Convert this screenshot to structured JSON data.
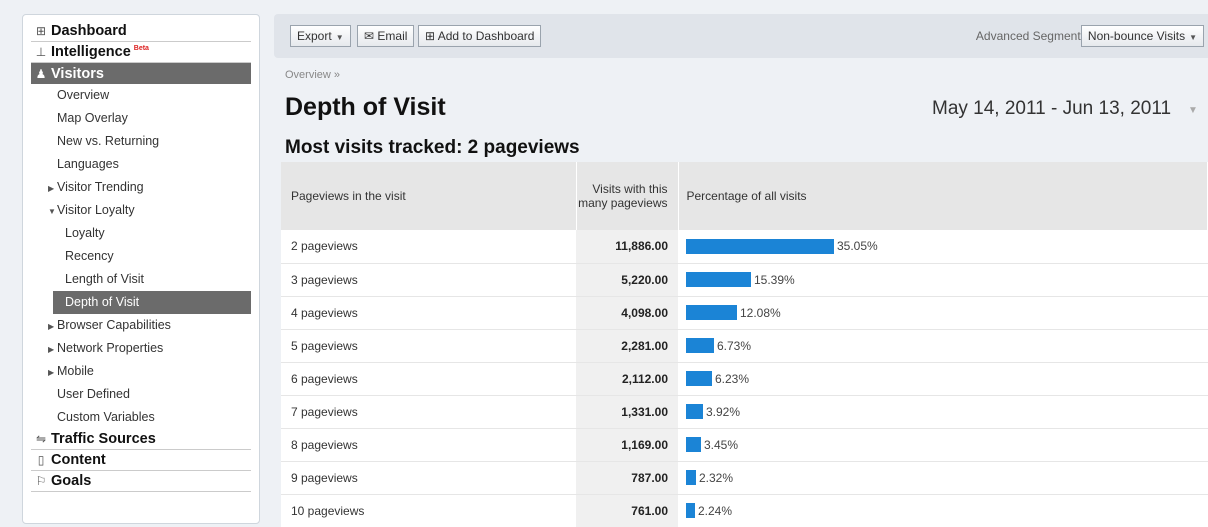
{
  "sidebar": {
    "dashboard": "Dashboard",
    "intelligence": "Intelligence",
    "beta": "Beta",
    "visitors": "Visitors",
    "items": [
      {
        "label": "Overview"
      },
      {
        "label": "Map Overlay"
      },
      {
        "label": "New vs. Returning"
      },
      {
        "label": "Languages"
      },
      {
        "label": "Visitor Trending"
      },
      {
        "label": "Visitor Loyalty"
      },
      {
        "label": "Loyalty"
      },
      {
        "label": "Recency"
      },
      {
        "label": "Length of Visit"
      },
      {
        "label": "Depth of Visit"
      },
      {
        "label": "Browser Capabilities"
      },
      {
        "label": "Network Properties"
      },
      {
        "label": "Mobile"
      },
      {
        "label": "User Defined"
      },
      {
        "label": "Custom Variables"
      }
    ],
    "traffic_sources": "Traffic Sources",
    "content": "Content",
    "goals": "Goals"
  },
  "toolbar": {
    "export_label": "Export",
    "email_label": "Email",
    "add_dashboard_label": "Add to Dashboard",
    "advanced_segments_label": "Advanced Segments:",
    "segment_value": "Non-bounce Visits"
  },
  "breadcrumb": "Overview »",
  "page_title": "Depth of Visit",
  "date_range": "May 14, 2011 - Jun 13, 2011",
  "subtitle": "Most visits tracked: 2 pageviews",
  "table": {
    "headers": [
      "Pageviews in the visit",
      "Visits with this many pageviews",
      "Percentage of all visits"
    ],
    "rows": [
      {
        "label": "2 pageviews",
        "visits": "11,886.00",
        "pct": "35.05%",
        "pct_value": 35.05
      },
      {
        "label": "3 pageviews",
        "visits": "5,220.00",
        "pct": "15.39%",
        "pct_value": 15.39
      },
      {
        "label": "4 pageviews",
        "visits": "4,098.00",
        "pct": "12.08%",
        "pct_value": 12.08
      },
      {
        "label": "5 pageviews",
        "visits": "2,281.00",
        "pct": "6.73%",
        "pct_value": 6.73
      },
      {
        "label": "6 pageviews",
        "visits": "2,112.00",
        "pct": "6.23%",
        "pct_value": 6.23
      },
      {
        "label": "7 pageviews",
        "visits": "1,331.00",
        "pct": "3.92%",
        "pct_value": 3.92
      },
      {
        "label": "8 pageviews",
        "visits": "1,169.00",
        "pct": "3.45%",
        "pct_value": 3.45
      },
      {
        "label": "9 pageviews",
        "visits": "787.00",
        "pct": "2.32%",
        "pct_value": 2.32
      },
      {
        "label": "10 pageviews",
        "visits": "761.00",
        "pct": "2.24%",
        "pct_value": 2.24
      }
    ]
  },
  "colors": {
    "bar": "#1b84d6",
    "selected_nav": "#6b6b6b"
  }
}
